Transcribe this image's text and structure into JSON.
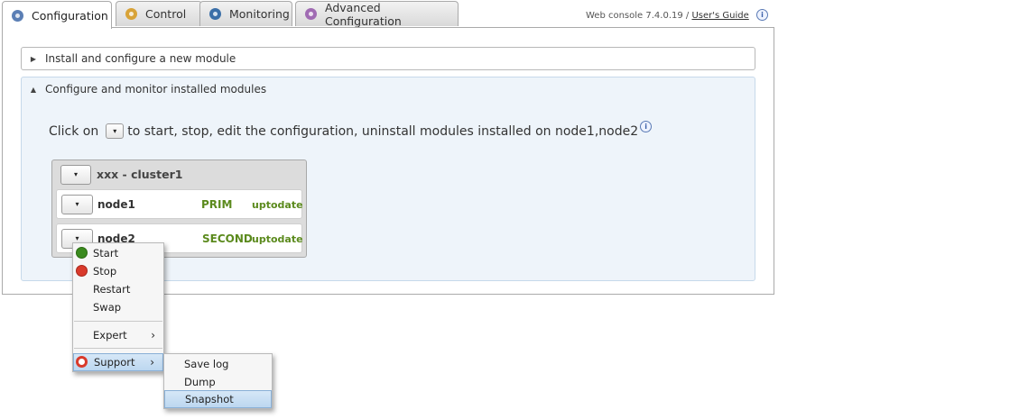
{
  "tabs": [
    {
      "label": "Configuration",
      "icon": "wrench-icon",
      "color": "#5b7fb5"
    },
    {
      "label": "Control",
      "icon": "check-icon",
      "color": "#d8a338"
    },
    {
      "label": "Monitoring",
      "icon": "monitor-icon",
      "color": "#3b6fa8"
    },
    {
      "label": "Advanced Configuration",
      "icon": "gear-icon",
      "color": "#a06bb3"
    }
  ],
  "header": {
    "version_text": "Web console 7.4.0.19 /",
    "guide_link": "User's Guide",
    "info_glyph": "i"
  },
  "accordion": {
    "install_title": "Install and configure a new module",
    "configure_title": "Configure and monitor installed modules"
  },
  "instructions": {
    "prefix": "Click on",
    "suffix": "to start, stop, edit the configuration, uninstall modules installed on node1,node2"
  },
  "cluster": {
    "title": "xxx - cluster1",
    "nodes": [
      {
        "name": "node1",
        "role": "PRIM",
        "state": "uptodate"
      },
      {
        "name": "node2",
        "role": "SECOND",
        "state": "uptodate"
      }
    ]
  },
  "dropdown_glyph": "▾",
  "context_menu": {
    "items": [
      "Start",
      "Stop",
      "Restart",
      "Swap"
    ],
    "expert": "Expert",
    "support": "Support",
    "chevron": "›"
  },
  "support_menu": {
    "items": [
      "Save log",
      "Dump",
      "Snapshot"
    ]
  },
  "colors": {
    "start_green": "#3a8a1e",
    "stop_red": "#d93a2b",
    "status_green": "#5b8a1d",
    "highlight_blue": "#bcd7f0"
  }
}
